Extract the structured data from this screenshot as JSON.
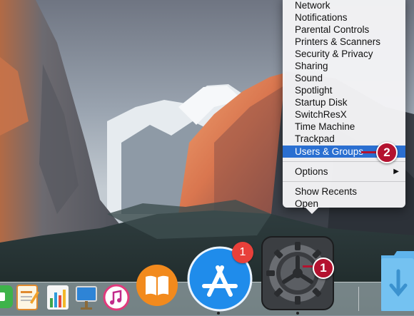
{
  "menu": {
    "items": [
      {
        "label": "Network"
      },
      {
        "label": "Notifications"
      },
      {
        "label": "Parental Controls"
      },
      {
        "label": "Printers & Scanners"
      },
      {
        "label": "Security & Privacy"
      },
      {
        "label": "Sharing"
      },
      {
        "label": "Sound"
      },
      {
        "label": "Spotlight"
      },
      {
        "label": "Startup Disk"
      },
      {
        "label": "SwitchResX"
      },
      {
        "label": "Time Machine"
      },
      {
        "label": "Trackpad"
      },
      {
        "label": "Users & Groups",
        "selected": true
      }
    ],
    "options_label": "Options",
    "show_recents_label": "Show Recents",
    "open_label": "Open"
  },
  "callouts": {
    "step1": "1",
    "step2": "2",
    "color": "#b4122f"
  },
  "dock": {
    "apps": [
      {
        "name": "FaceTime",
        "icon": "facetime-icon"
      },
      {
        "name": "Pages",
        "icon": "pages-icon"
      },
      {
        "name": "Numbers",
        "icon": "numbers-icon"
      },
      {
        "name": "Keynote",
        "icon": "keynote-icon"
      },
      {
        "name": "iTunes",
        "icon": "itunes-icon"
      },
      {
        "name": "iBooks",
        "icon": "ibooks-icon"
      },
      {
        "name": "App Store",
        "icon": "app-store-icon",
        "badge": "1"
      },
      {
        "name": "System Preferences",
        "icon": "gear-icon",
        "running": true
      },
      {
        "name": "Downloads",
        "icon": "folder-icon"
      }
    ],
    "app_store_badge": "1"
  }
}
